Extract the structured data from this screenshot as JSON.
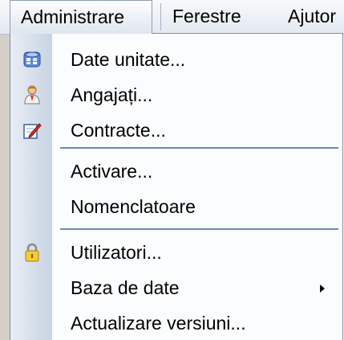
{
  "menubar": {
    "items": [
      {
        "label": "Administrare",
        "active": true
      },
      {
        "label": "Ferestre"
      },
      {
        "label": "Ajutor"
      }
    ]
  },
  "dropdown": {
    "groups": [
      [
        {
          "label": "Date unitate...",
          "icon": "database-icon"
        },
        {
          "label": "Angajați...",
          "icon": "employee-icon"
        },
        {
          "label": "Contracte...",
          "icon": "contract-edit-icon"
        }
      ],
      [
        {
          "label": "Activare..."
        },
        {
          "label": "Nomenclatoare"
        }
      ],
      [
        {
          "label": "Utilizatori...",
          "icon": "lock-icon"
        },
        {
          "label": "Baza de date",
          "submenu": true
        },
        {
          "label": "Actualizare versiuni..."
        }
      ]
    ]
  },
  "colors": {
    "separator": "#6f87b8",
    "gutter_start": "#e9eef5",
    "gutter_end": "#c8d3e2",
    "menubar_bg": "#e3e9f1"
  }
}
